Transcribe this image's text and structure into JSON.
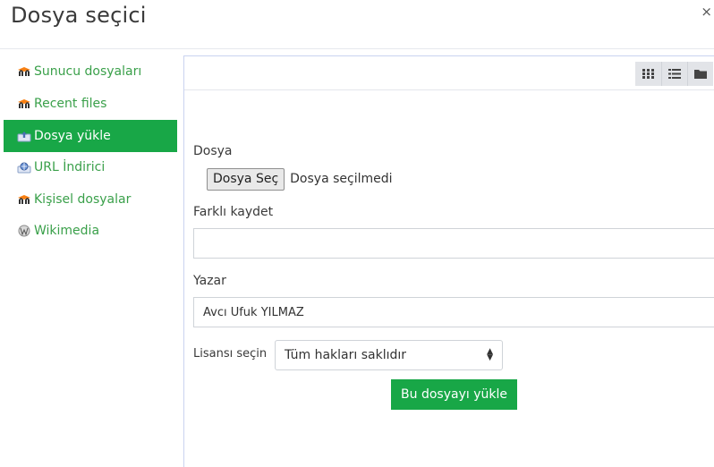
{
  "dialog": {
    "title": "Dosya seçici",
    "close_glyph": "×"
  },
  "sidebar": {
    "items": [
      {
        "label": "Sunucu dosyaları",
        "icon": "moodle-icon",
        "active": false
      },
      {
        "label": "Recent files",
        "icon": "moodle-icon",
        "active": false
      },
      {
        "label": "Dosya yükle",
        "icon": "upload-icon",
        "active": true
      },
      {
        "label": "URL İndirici",
        "icon": "url-downloader-icon",
        "active": false
      },
      {
        "label": "Kişisel dosyalar",
        "icon": "moodle-icon",
        "active": false
      },
      {
        "label": "Wikimedia",
        "icon": "wikimedia-icon",
        "active": false
      }
    ]
  },
  "toolbar": {
    "views": [
      "grid-view-icon",
      "list-view-icon",
      "folder-view-icon"
    ]
  },
  "form": {
    "file_label": "Dosya",
    "file_button": "Dosya Seç",
    "file_status": "Dosya seçilmedi",
    "saveas_label": "Farklı kaydet",
    "saveas_value": "",
    "author_label": "Yazar",
    "author_value": "Avcı Ufuk YILMAZ",
    "license_label": "Lisansı seçin",
    "license_value": "Tüm hakları saklıdır",
    "upload_button": "Bu dosyayı yükle"
  },
  "colors": {
    "accent": "#18a747",
    "link": "#3aa04a",
    "panel_border": "#c9d3f0"
  }
}
